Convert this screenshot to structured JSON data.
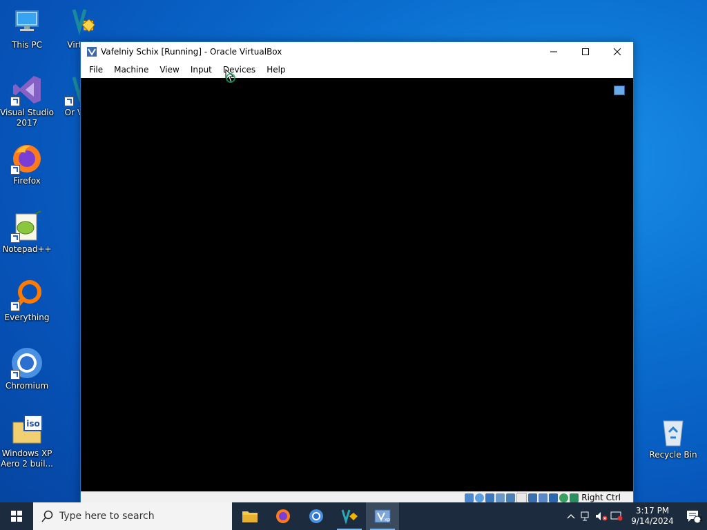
{
  "desktop": {
    "icons": [
      {
        "label": "This PC"
      },
      {
        "label": "Virtual"
      },
      {
        "label": "Visual Studio 2017"
      },
      {
        "label": "Or Virtu"
      },
      {
        "label": "Firefox"
      },
      {
        "label": "Notepad++"
      },
      {
        "label": "Everything"
      },
      {
        "label": "Chromium"
      },
      {
        "label": "Windows XP Aero 2 buil..."
      },
      {
        "label": "Recycle Bin"
      }
    ]
  },
  "window": {
    "title": "Vafelniy  Schix [Running] - Oracle VirtualBox",
    "controls": {
      "minimize": "—",
      "maximize": "☐",
      "close": "✕"
    },
    "menu": [
      "File",
      "Machine",
      "View",
      "Input",
      "Devices",
      "Help"
    ],
    "status": {
      "host_key": "Right Ctrl"
    }
  },
  "taskbar": {
    "search_placeholder": "Type here to search",
    "clock": {
      "time": "3:17 PM",
      "date": "9/14/2024"
    },
    "notification_badge": "1"
  },
  "colors": {
    "desktop_bg": "#0a6fd0",
    "taskbar_bg": "#1c2b3e",
    "window_border": "#1f6fc0"
  }
}
